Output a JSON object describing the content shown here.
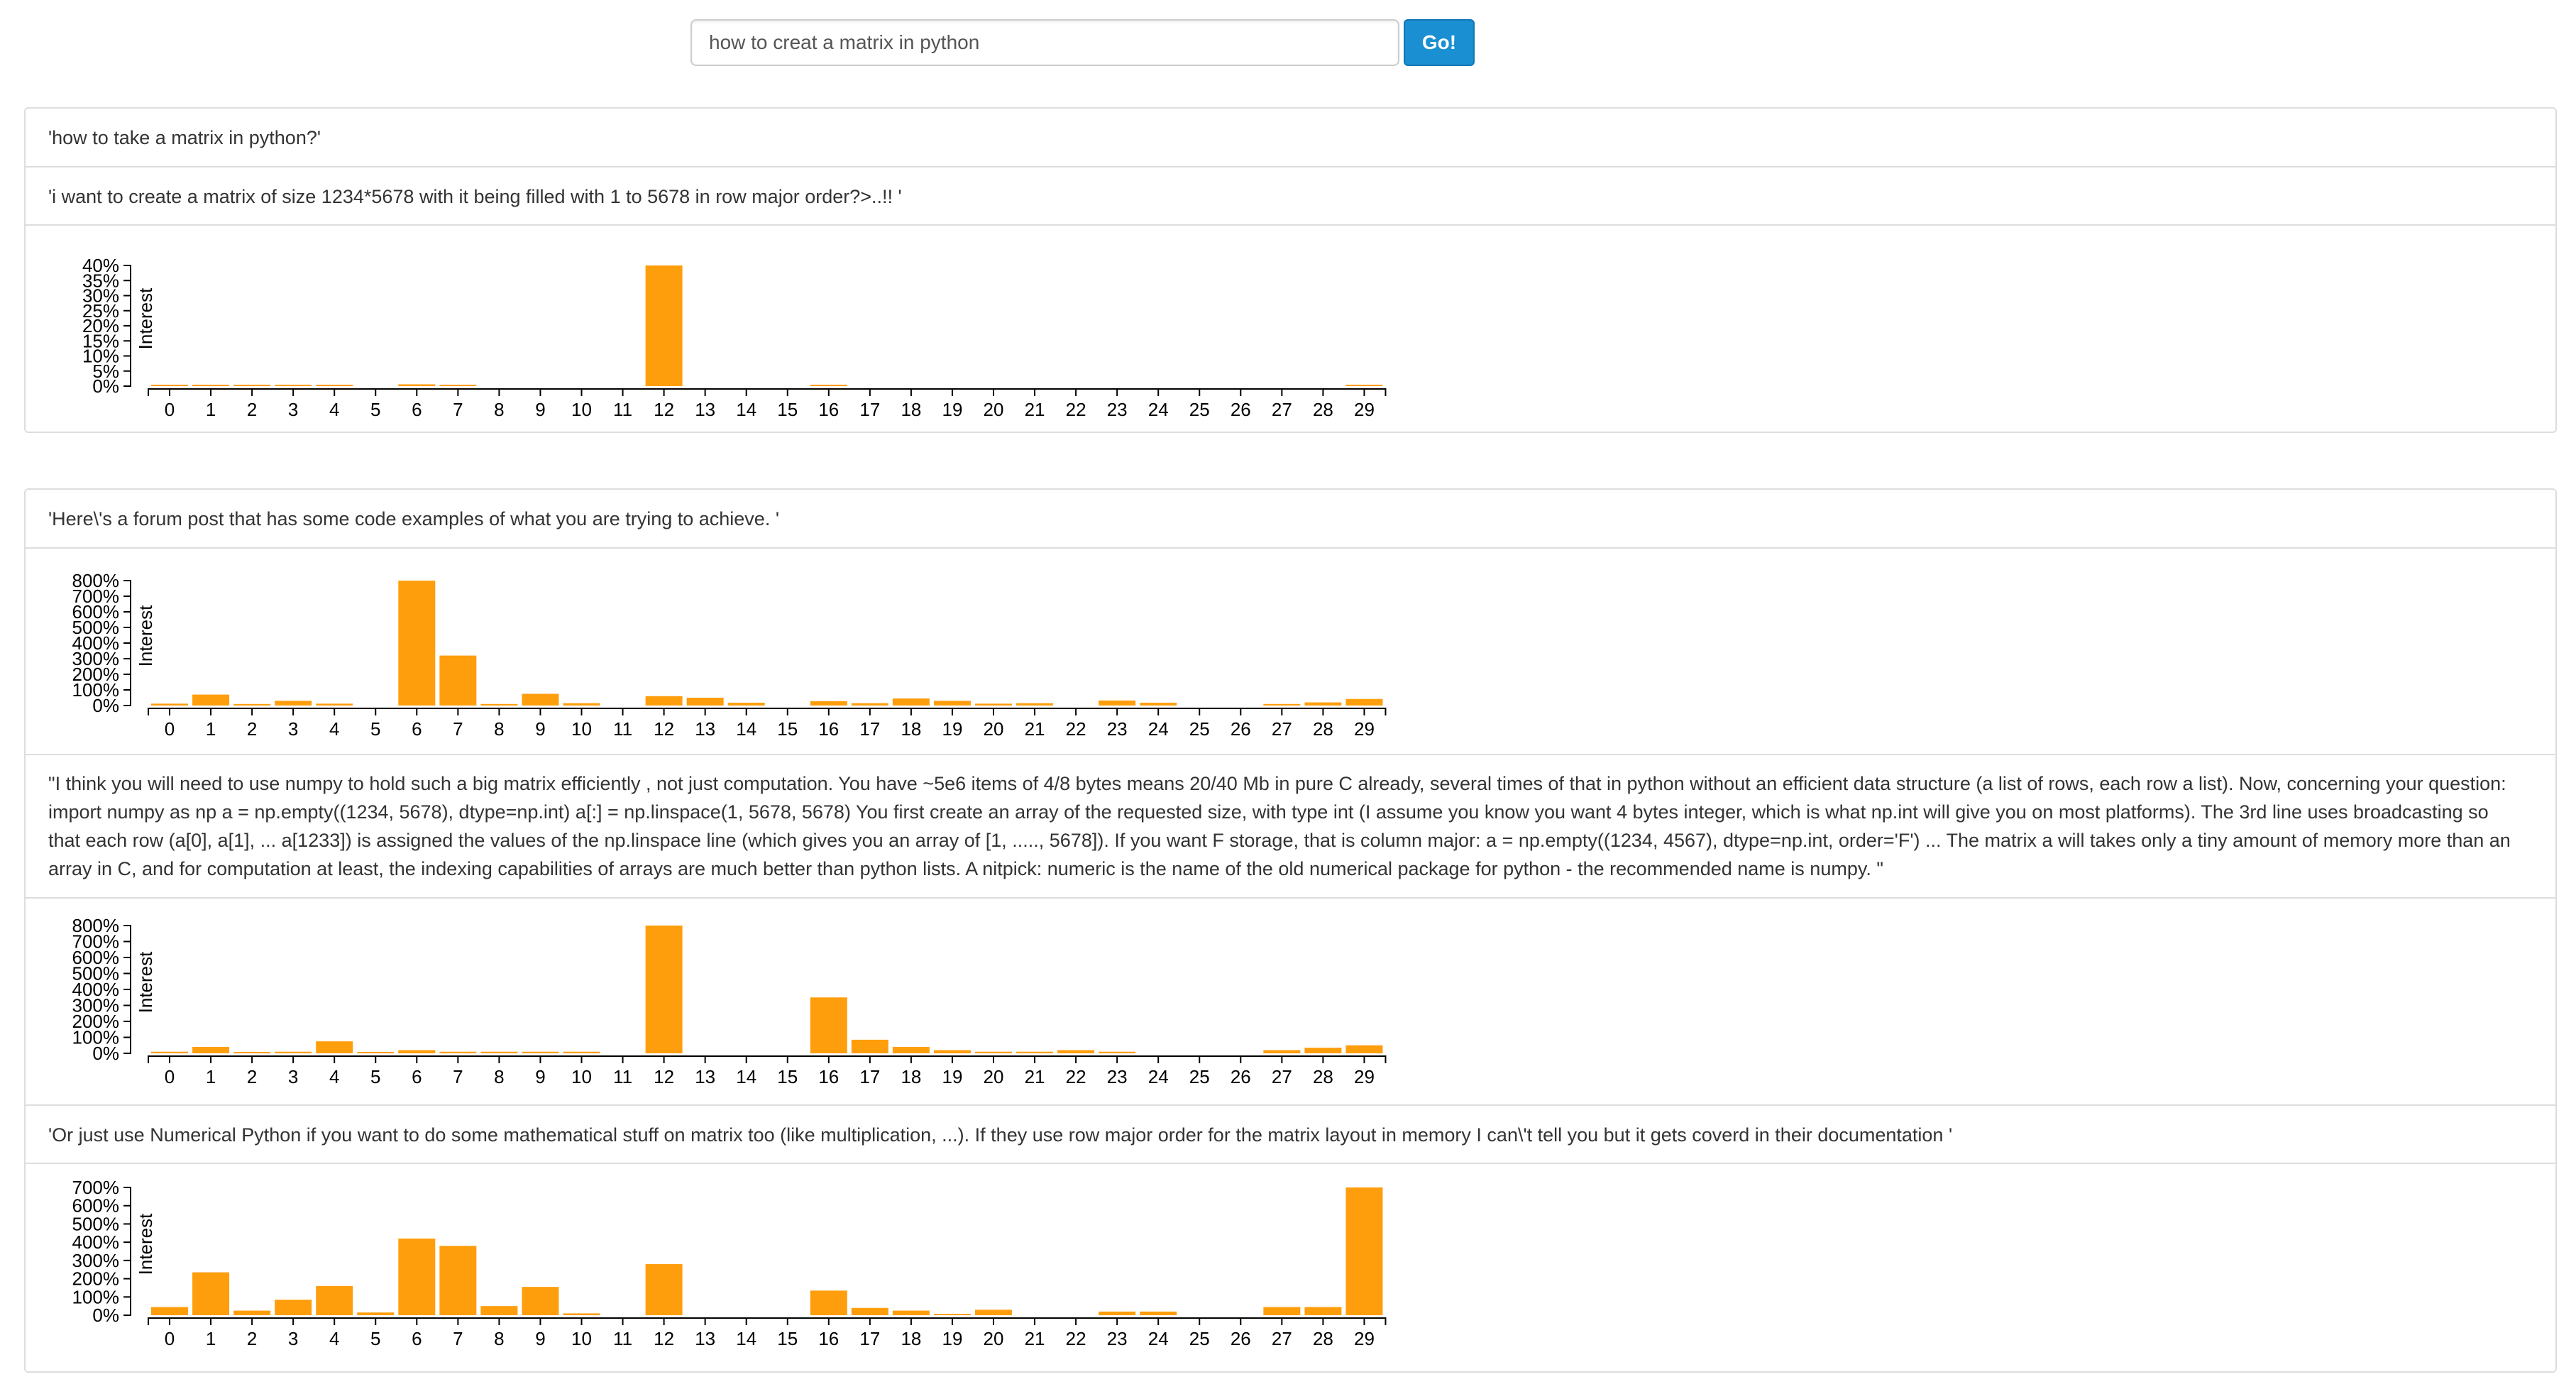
{
  "search": {
    "query": "how to creat a matrix in python",
    "button_label": "Go!"
  },
  "colors": {
    "bar": "#ff9e0c",
    "button": "#1a8fd2"
  },
  "threads": [
    {
      "question_title": "'how to take a matrix in python?'",
      "question_body": "'i want to create a matrix of size 1234*5678 with it being filled with 1 to 5678 in row major order?>..!! '",
      "chart_data": {
        "type": "bar",
        "ylabel": "Interest",
        "categories": [
          "0",
          "1",
          "2",
          "3",
          "4",
          "5",
          "6",
          "7",
          "8",
          "9",
          "10",
          "11",
          "12",
          "13",
          "14",
          "15",
          "16",
          "17",
          "18",
          "19",
          "20",
          "21",
          "22",
          "23",
          "24",
          "25",
          "26",
          "27",
          "28",
          "29"
        ],
        "yticks": [
          "0%",
          "5%",
          "10%",
          "15%",
          "20%",
          "25%",
          "30%",
          "35%",
          "40%"
        ],
        "ylim": [
          0,
          40
        ],
        "values": [
          0.2,
          0.2,
          0.2,
          0.2,
          0.2,
          0,
          0.6,
          0.4,
          0,
          0,
          0,
          0,
          40,
          0,
          0,
          0,
          0.3,
          0,
          0,
          0,
          0,
          0,
          0,
          0,
          0,
          0,
          0,
          0,
          0,
          0.4
        ]
      }
    }
  ],
  "answers": [
    {
      "text": "'Here\\'s a forum post that has some code examples of what you are trying to achieve. '",
      "chart_data": {
        "type": "bar",
        "ylabel": "Interest",
        "categories": [
          "0",
          "1",
          "2",
          "3",
          "4",
          "5",
          "6",
          "7",
          "8",
          "9",
          "10",
          "11",
          "12",
          "13",
          "14",
          "15",
          "16",
          "17",
          "18",
          "19",
          "20",
          "21",
          "22",
          "23",
          "24",
          "25",
          "26",
          "27",
          "28",
          "29"
        ],
        "yticks": [
          "0%",
          "100%",
          "200%",
          "300%",
          "400%",
          "500%",
          "600%",
          "700%",
          "800%"
        ],
        "ylim": [
          0,
          800
        ],
        "values": [
          12,
          70,
          10,
          30,
          12,
          0,
          800,
          320,
          10,
          75,
          15,
          0,
          60,
          50,
          18,
          0,
          28,
          15,
          45,
          30,
          12,
          15,
          0,
          32,
          18,
          0,
          0,
          10,
          20,
          42
        ]
      }
    },
    {
      "text": "\"I think you will need to use numpy to hold such a big matrix efficiently , not just computation. You have ~5e6 items of 4/8 bytes means 20/40 Mb in pure C already, several times of that in python without an efficient data structure (a list of rows, each row a list). Now, concerning your question: import numpy as np a = np.empty((1234, 5678), dtype=np.int) a[:] = np.linspace(1, 5678, 5678) You first create an array of the requested size, with type int (I assume you know you want 4 bytes integer, which is what np.int will give you on most platforms). The 3rd line uses broadcasting so that each row (a[0], a[1], ... a[1233]) is assigned the values of the np.linspace line (which gives you an array of [1, ....., 5678]). If you want F storage, that is column major: a = np.empty((1234, 4567), dtype=np.int, order='F') ... The matrix a will takes only a tiny amount of memory more than an array in C, and for computation at least, the indexing capabilities of arrays are much better than python lists. A nitpick: numeric is the name of the old numerical package for python - the recommended name is numpy. \"",
      "chart_data": {
        "type": "bar",
        "ylabel": "Interest",
        "categories": [
          "0",
          "1",
          "2",
          "3",
          "4",
          "5",
          "6",
          "7",
          "8",
          "9",
          "10",
          "11",
          "12",
          "13",
          "14",
          "15",
          "16",
          "17",
          "18",
          "19",
          "20",
          "21",
          "22",
          "23",
          "24",
          "25",
          "26",
          "27",
          "28",
          "29"
        ],
        "yticks": [
          "0%",
          "100%",
          "200%",
          "300%",
          "400%",
          "500%",
          "600%",
          "700%",
          "800%"
        ],
        "ylim": [
          0,
          800
        ],
        "values": [
          10,
          40,
          5,
          10,
          75,
          5,
          20,
          10,
          10,
          10,
          10,
          0,
          800,
          0,
          0,
          0,
          350,
          85,
          40,
          20,
          10,
          10,
          20,
          10,
          0,
          0,
          0,
          20,
          35,
          50
        ]
      }
    },
    {
      "text": "'Or just use Numerical Python if you want to do some mathematical stuff on matrix too (like multiplication, ...). If they use row major order for the matrix layout in memory I can\\'t tell you but it gets coverd in their documentation '",
      "chart_data": {
        "type": "bar",
        "ylabel": "Interest",
        "categories": [
          "0",
          "1",
          "2",
          "3",
          "4",
          "5",
          "6",
          "7",
          "8",
          "9",
          "10",
          "11",
          "12",
          "13",
          "14",
          "15",
          "16",
          "17",
          "18",
          "19",
          "20",
          "21",
          "22",
          "23",
          "24",
          "25",
          "26",
          "27",
          "28",
          "29"
        ],
        "yticks": [
          "0%",
          "100%",
          "200%",
          "300%",
          "400%",
          "500%",
          "600%",
          "700%"
        ],
        "ylim": [
          0,
          700
        ],
        "values": [
          45,
          235,
          25,
          85,
          160,
          15,
          420,
          380,
          50,
          155,
          10,
          0,
          280,
          0,
          0,
          0,
          135,
          40,
          25,
          5,
          30,
          0,
          0,
          20,
          20,
          0,
          0,
          45,
          45,
          700
        ]
      }
    }
  ]
}
